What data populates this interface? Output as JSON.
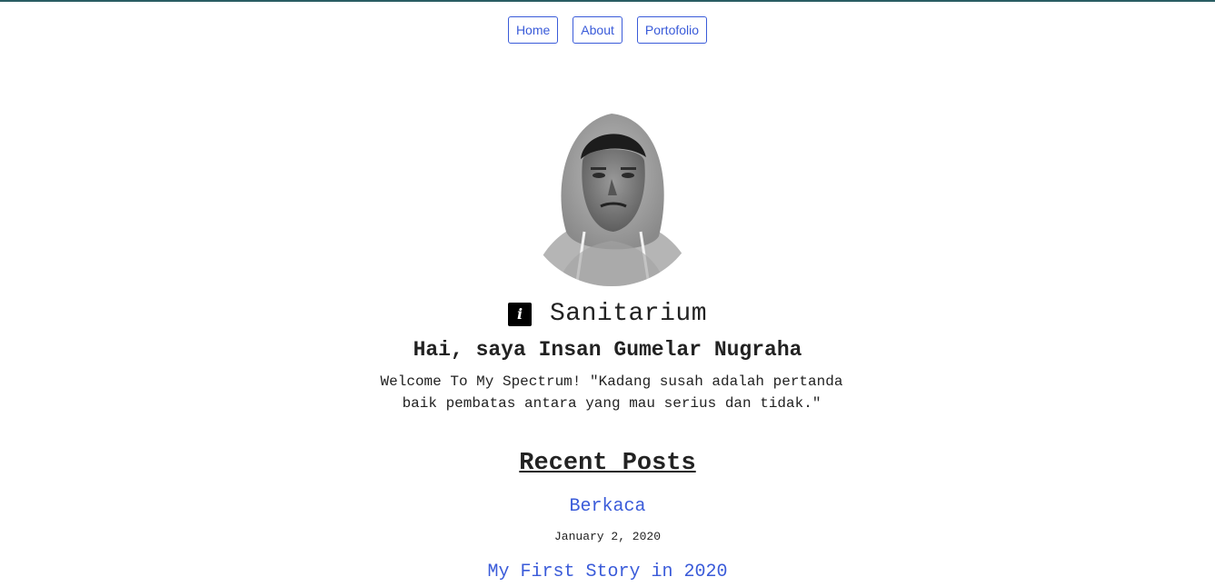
{
  "nav": {
    "items": [
      "Home",
      "About",
      "Portofolio"
    ]
  },
  "brand": {
    "icon": "i-logo-icon",
    "name": "Sanitarium"
  },
  "intro": {
    "greeting": "Hai, saya Insan Gumelar Nugraha",
    "tagline": "Welcome To My Spectrum! \"Kadang susah adalah pertanda baik pembatas antara yang mau serius dan tidak.\""
  },
  "recent": {
    "title": "Recent Posts",
    "posts": [
      {
        "title": "Berkaca",
        "date": "January 2, 2020"
      },
      {
        "title": "My First Story in 2020",
        "date": ""
      }
    ]
  },
  "colors": {
    "link": "#3a5bd9",
    "top_border": "#2a5d63",
    "text": "#222222"
  }
}
